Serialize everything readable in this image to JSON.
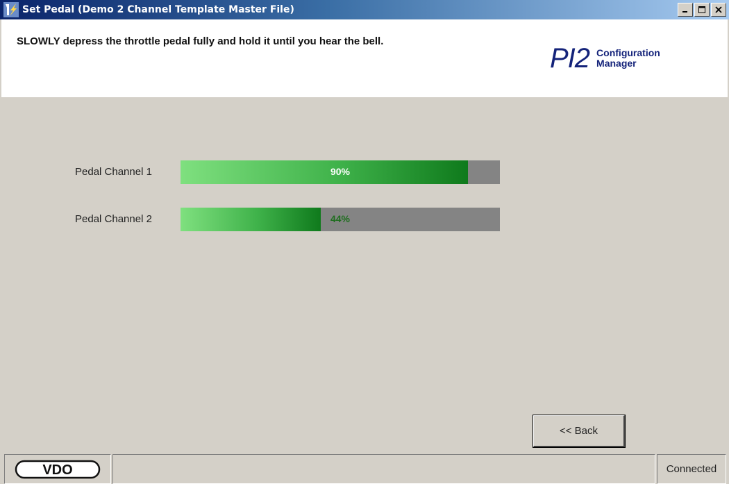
{
  "window": {
    "title": "Set Pedal (Demo 2 Channel Template Master File)"
  },
  "header": {
    "instruction": "SLOWLY depress the throttle pedal fully and hold it until you hear the bell.",
    "logo_main": "PI2",
    "logo_sub_line1": "Configuration",
    "logo_sub_line2": "Manager"
  },
  "channels": [
    {
      "label": "Pedal Channel 1",
      "percent_text": "90%",
      "fill_percent": 90
    },
    {
      "label": "Pedal Channel 2",
      "percent_text": "44%",
      "fill_percent": 44
    }
  ],
  "buttons": {
    "back_label": "<< Back"
  },
  "statusbar": {
    "brand": "VDO",
    "connection": "Connected"
  },
  "colors": {
    "title_gradient_start": "#0a246a",
    "logo_blue": "#14237a",
    "bar_track": "#848484",
    "bar_fill_dark": "#0f7a1c",
    "bar_fill_light": "#7fe07f"
  }
}
